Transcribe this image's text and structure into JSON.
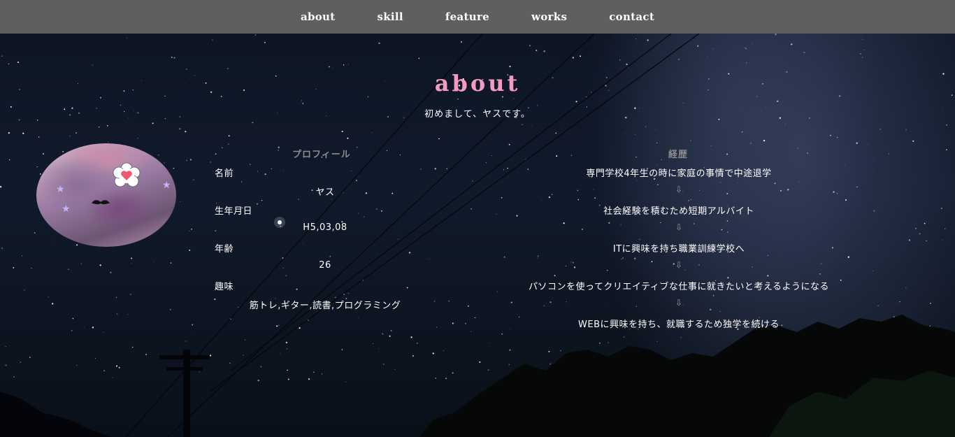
{
  "nav": {
    "items": [
      {
        "label": "about"
      },
      {
        "label": "skill"
      },
      {
        "label": "feature"
      },
      {
        "label": "works"
      },
      {
        "label": "contact"
      }
    ]
  },
  "about": {
    "title": "about",
    "intro": "初めまして、ヤスです。",
    "profile": {
      "heading": "プロフィール",
      "rows": [
        {
          "label": "名前",
          "value": "ヤス"
        },
        {
          "label": "生年月日",
          "value": "H5,03,08"
        },
        {
          "label": "年齢",
          "value": "26"
        },
        {
          "label": "趣味",
          "value": "筋トレ,ギター,読書,プログラミング"
        }
      ]
    },
    "history": {
      "heading": "経歴",
      "steps": [
        "専門学校4年生の時に家庭の事情で中途退学",
        "社会経験を積むため短期アルバイト",
        "ITに興味を持ち職業訓練学校へ",
        "パソコンを使ってクリエイティブな仕事に就きたいと考えるようになる",
        "WEBに興味を持ち、就職するため独学を続ける"
      ],
      "arrow": "⇩"
    }
  },
  "colors": {
    "nav_bg": "#5f605d",
    "title_pink": "#f49ac2",
    "heading_gray": "#8d8d8d"
  }
}
